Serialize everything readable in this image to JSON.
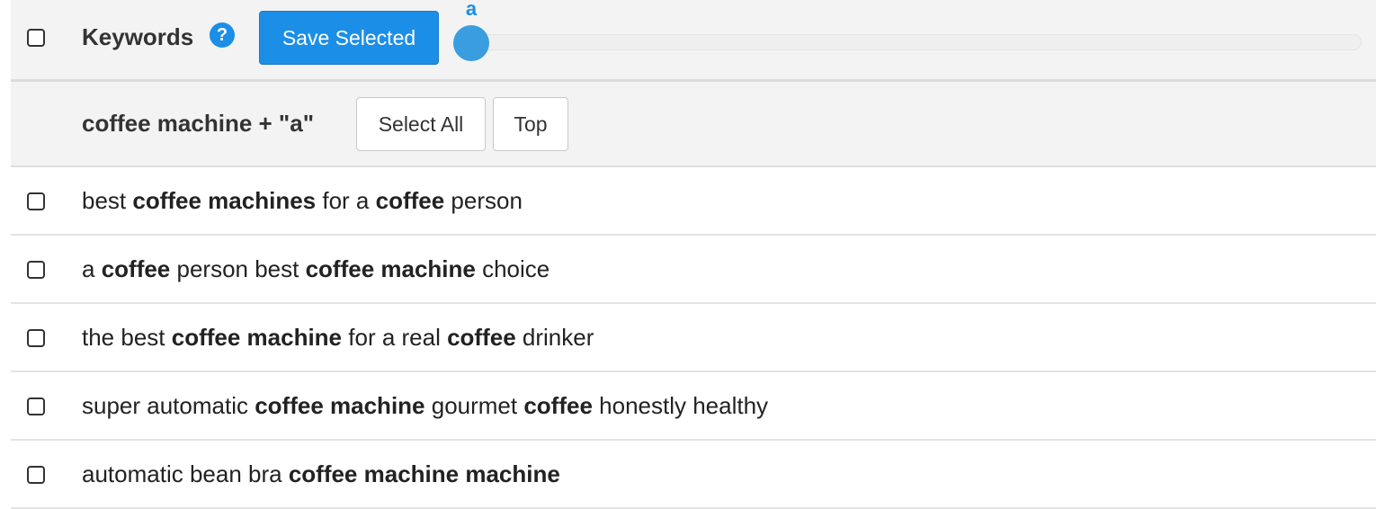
{
  "header": {
    "title": "Keywords",
    "help_icon_glyph": "?",
    "save_label": "Save Selected",
    "slider_value_label": "a",
    "slider_position": 0
  },
  "group": {
    "title": "coffee machine + \"a\"",
    "select_all_label": "Select All",
    "top_label": "Top"
  },
  "rows": [
    {
      "segments": [
        {
          "text": "best ",
          "bold": false
        },
        {
          "text": "coffee machines",
          "bold": true
        },
        {
          "text": " for a ",
          "bold": false
        },
        {
          "text": "coffee",
          "bold": true
        },
        {
          "text": " person",
          "bold": false
        }
      ]
    },
    {
      "segments": [
        {
          "text": "a ",
          "bold": false
        },
        {
          "text": "coffee",
          "bold": true
        },
        {
          "text": " person best ",
          "bold": false
        },
        {
          "text": "coffee machine",
          "bold": true
        },
        {
          "text": " choice",
          "bold": false
        }
      ]
    },
    {
      "segments": [
        {
          "text": "the best ",
          "bold": false
        },
        {
          "text": "coffee machine",
          "bold": true
        },
        {
          "text": " for a real ",
          "bold": false
        },
        {
          "text": "coffee",
          "bold": true
        },
        {
          "text": " drinker",
          "bold": false
        }
      ]
    },
    {
      "segments": [
        {
          "text": "super automatic ",
          "bold": false
        },
        {
          "text": "coffee machine",
          "bold": true
        },
        {
          "text": " gourmet ",
          "bold": false
        },
        {
          "text": "coffee",
          "bold": true
        },
        {
          "text": " honestly healthy",
          "bold": false
        }
      ]
    },
    {
      "segments": [
        {
          "text": "automatic bean bra ",
          "bold": false
        },
        {
          "text": "coffee machine machine",
          "bold": true
        }
      ]
    }
  ],
  "colors": {
    "accent": "#1b8ee8",
    "slider_handle": "#3a9de0",
    "header_bg": "#f3f3f3"
  }
}
